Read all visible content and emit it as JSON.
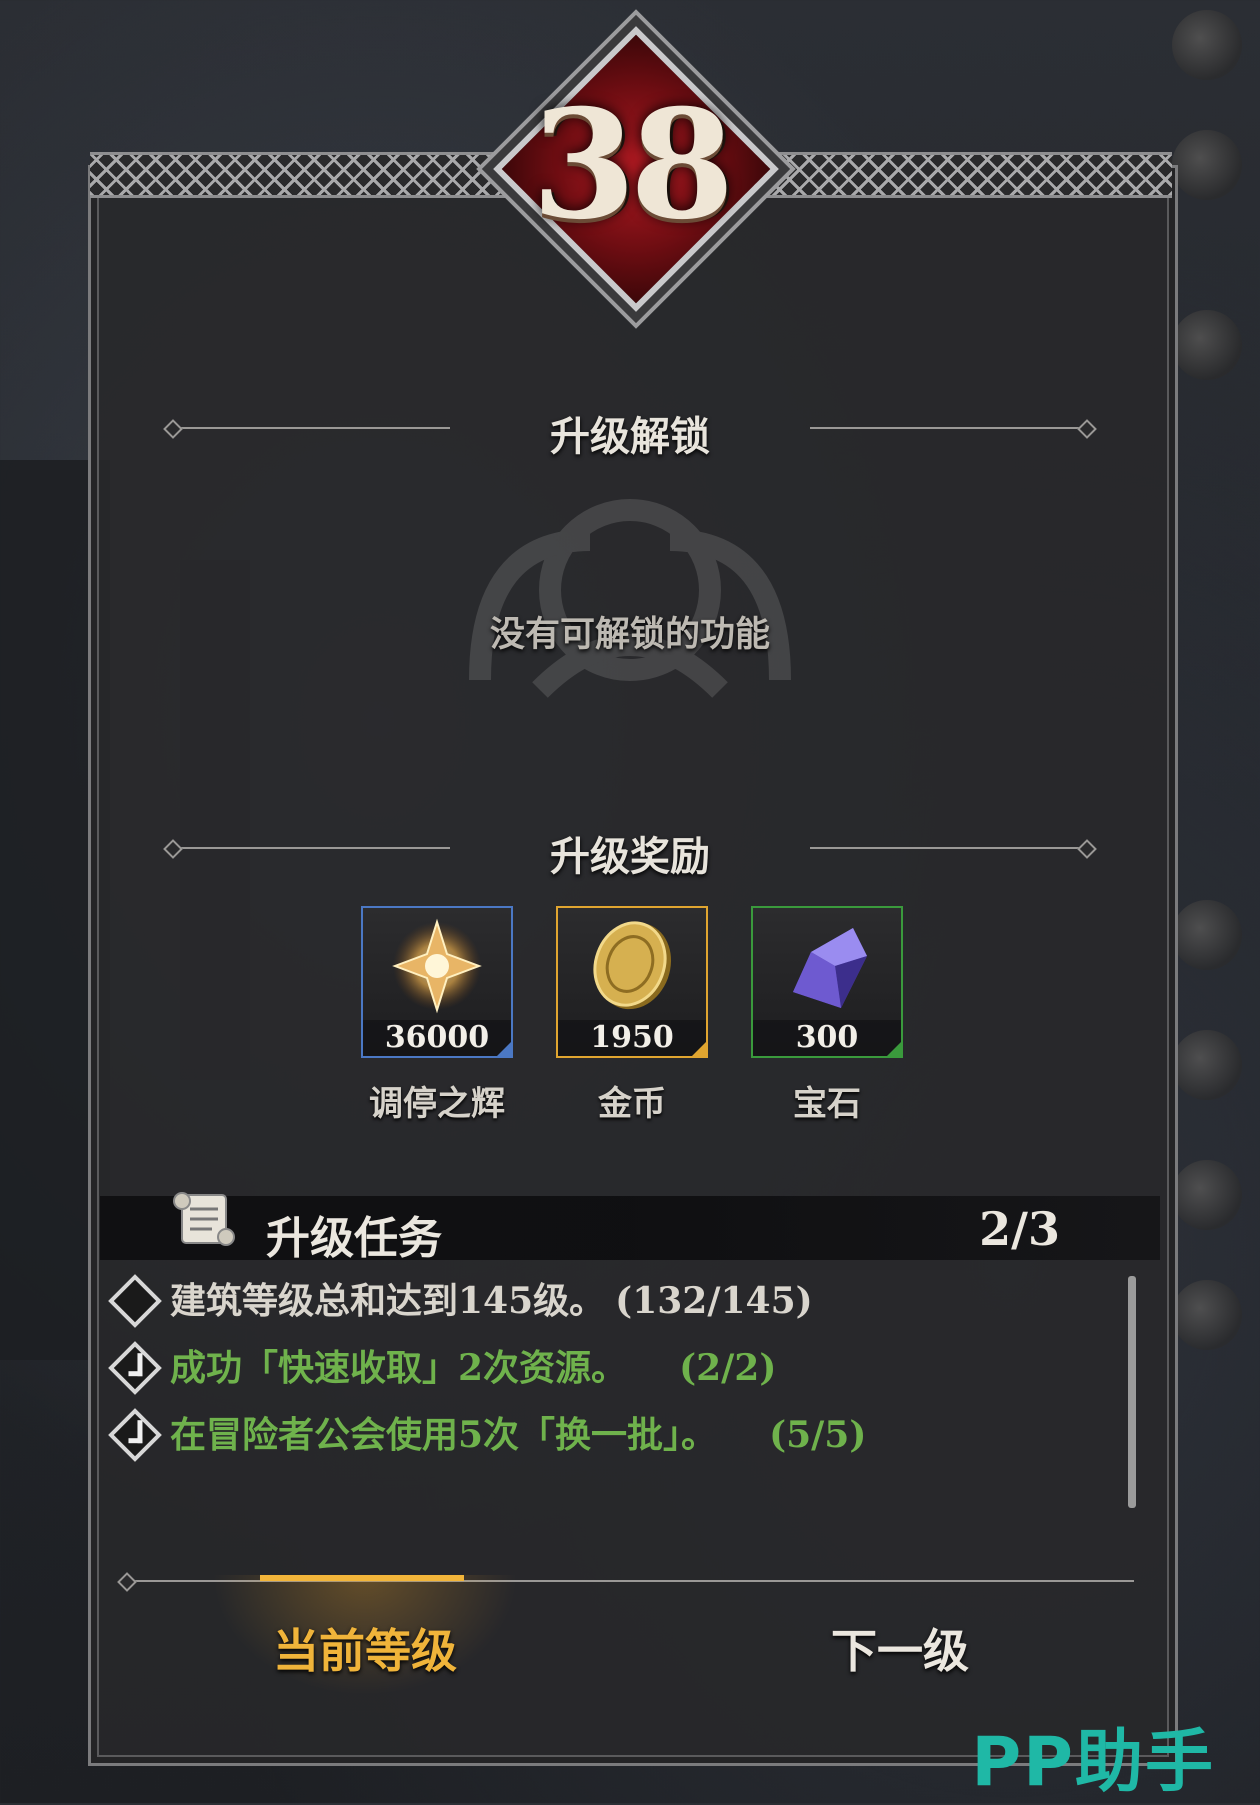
{
  "level": {
    "number": "38"
  },
  "unlock": {
    "title": "升级解锁",
    "empty_text": "没有可解锁的功能"
  },
  "rewards": {
    "title": "升级奖励",
    "items": [
      {
        "name": "调停之辉",
        "amount": "36000",
        "border_color": "#4b78c4",
        "icon": "radiant-star-icon"
      },
      {
        "name": "金币",
        "amount": "1950",
        "border_color": "#e0a530",
        "icon": "gold-coin-icon"
      },
      {
        "name": "宝石",
        "amount": "300",
        "border_color": "#3a9a3c",
        "icon": "purple-gem-icon"
      }
    ]
  },
  "tasks": {
    "title": "升级任务",
    "count": "2/3",
    "items": [
      {
        "text": "建筑等级总和达到145级。",
        "progress": "(132/145)",
        "done": false
      },
      {
        "text": "成功「快速收取」2次资源。",
        "progress": "(2/2)",
        "done": true
      },
      {
        "text": "在冒险者公会使用5次「换一批」。",
        "progress": "(5/5)",
        "done": true
      }
    ]
  },
  "tabs": {
    "current": "当前等级",
    "next": "下一级"
  },
  "watermark": "PP助手",
  "colors": {
    "accent_gold": "#f0b43a",
    "done_green": "#6fb24c",
    "level_red": "#b11a22"
  }
}
